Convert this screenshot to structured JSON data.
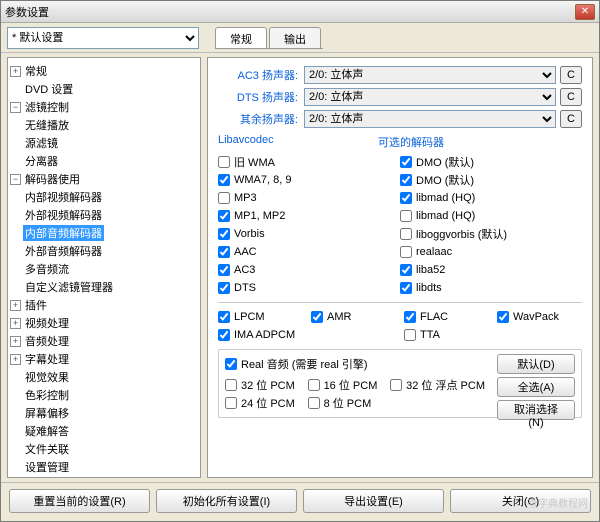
{
  "window": {
    "title": "参数设置"
  },
  "toolbar": {
    "profile_selected": "* 默认设置"
  },
  "tabs": {
    "general": "常规",
    "output": "输出"
  },
  "tree": [
    {
      "label": "常规",
      "level": 0,
      "exp": "plus"
    },
    {
      "label": "DVD 设置",
      "level": 0,
      "exp": "none"
    },
    {
      "label": "滤镜控制",
      "level": 0,
      "exp": "minus"
    },
    {
      "label": "无缝播放",
      "level": 1,
      "exp": "none"
    },
    {
      "label": "源滤镜",
      "level": 1,
      "exp": "none"
    },
    {
      "label": "分离器",
      "level": 1,
      "exp": "none"
    },
    {
      "label": "解码器使用",
      "level": 1,
      "exp": "minus"
    },
    {
      "label": "内部视频解码器",
      "level": 2,
      "exp": "none"
    },
    {
      "label": "外部视频解码器",
      "level": 2,
      "exp": "none"
    },
    {
      "label": "内部音频解码器",
      "level": 2,
      "exp": "none",
      "selected": true
    },
    {
      "label": "外部音频解码器",
      "level": 2,
      "exp": "none"
    },
    {
      "label": "多音频流",
      "level": 1,
      "exp": "none"
    },
    {
      "label": "自定义滤镜管理器",
      "level": 1,
      "exp": "none"
    },
    {
      "label": "插件",
      "level": 0,
      "exp": "plus"
    },
    {
      "label": "视频处理",
      "level": 0,
      "exp": "plus"
    },
    {
      "label": "音频处理",
      "level": 0,
      "exp": "plus"
    },
    {
      "label": "字幕处理",
      "level": 0,
      "exp": "plus"
    },
    {
      "label": "视觉效果",
      "level": 0,
      "exp": "none"
    },
    {
      "label": "色彩控制",
      "level": 0,
      "exp": "none"
    },
    {
      "label": "屏幕偏移",
      "level": 0,
      "exp": "none"
    },
    {
      "label": "疑难解答",
      "level": 0,
      "exp": "none"
    },
    {
      "label": "文件关联",
      "level": 0,
      "exp": "none"
    },
    {
      "label": "设置管理",
      "level": 0,
      "exp": "none"
    }
  ],
  "speakers": {
    "rows": [
      {
        "label": "AC3 扬声器:",
        "value": "2/0: 立体声"
      },
      {
        "label": "DTS 扬声器:",
        "value": "2/0: 立体声"
      },
      {
        "label": "其余扬声器:",
        "value": "2/0: 立体声"
      }
    ],
    "cbtn": "C"
  },
  "headers": {
    "libav": "Libavcodec",
    "optional": "可选的解码器"
  },
  "codecs_left": [
    {
      "label": "旧 WMA",
      "checked": false
    },
    {
      "label": "WMA7, 8, 9",
      "checked": true
    },
    {
      "label": "MP3",
      "checked": false
    },
    {
      "label": "MP1, MP2",
      "checked": true
    },
    {
      "label": "Vorbis",
      "checked": true
    },
    {
      "label": "AAC",
      "checked": true
    },
    {
      "label": "AC3",
      "checked": true
    },
    {
      "label": "DTS",
      "checked": true
    }
  ],
  "codecs_right": [
    {
      "label": "DMO (默认)",
      "checked": true
    },
    {
      "label": "DMO (默认)",
      "checked": true
    },
    {
      "label": "libmad (HQ)",
      "checked": true
    },
    {
      "label": "libmad (HQ)",
      "checked": false
    },
    {
      "label": "liboggvorbis (默认)",
      "checked": false
    },
    {
      "label": "realaac",
      "checked": false
    },
    {
      "label": "liba52",
      "checked": true
    },
    {
      "label": "libdts",
      "checked": true
    }
  ],
  "lossless": [
    {
      "label": "LPCM",
      "checked": true
    },
    {
      "label": "AMR",
      "checked": true
    },
    {
      "label": "FLAC",
      "checked": true
    },
    {
      "label": "WavPack",
      "checked": true
    },
    {
      "label": "IMA ADPCM",
      "checked": true
    },
    {
      "label": "",
      "checked": false,
      "hidden": true
    },
    {
      "label": "TTA",
      "checked": false
    }
  ],
  "real": {
    "title": "Real 音频 (需要 real 引擎)",
    "title_checked": true,
    "items": [
      {
        "label": "32 位 PCM",
        "checked": false
      },
      {
        "label": "16 位 PCM",
        "checked": false
      },
      {
        "label": "32 位 浮点 PCM",
        "checked": false
      },
      {
        "label": "24 位 PCM",
        "checked": false
      },
      {
        "label": "8 位 PCM",
        "checked": false
      }
    ],
    "buttons": {
      "default": "默认(D)",
      "all": "全选(A)",
      "none": "取消选择(N)"
    }
  },
  "footer": {
    "reset": "重置当前的设置(R)",
    "init": "初始化所有设置(I)",
    "export": "导出设置(E)",
    "close": "关闭(C)"
  },
  "watermark": "查字典教程网"
}
